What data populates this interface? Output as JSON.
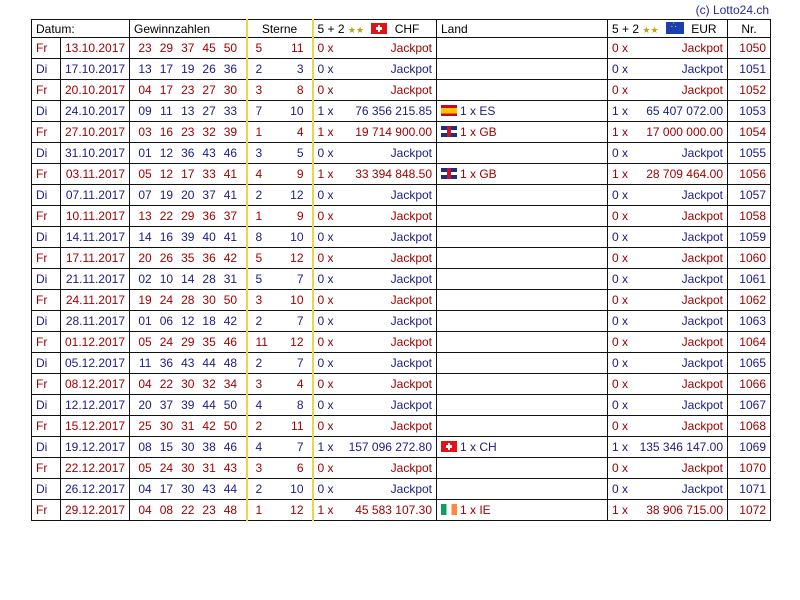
{
  "copyright": "(c) Lotto24.ch",
  "headers": {
    "datum": "Datum:",
    "gewinnzahlen": "Gewinnzahlen",
    "sterne": "Sterne",
    "chf_label": "5 + 2",
    "chf_cur": "CHF",
    "land": "Land",
    "eur_label": "5 + 2",
    "eur_cur": "EUR",
    "nr": "Nr."
  },
  "rows": [
    {
      "day": "Fr",
      "date": "13.10.2017",
      "nums": [
        "23",
        "29",
        "37",
        "45",
        "50"
      ],
      "stars": [
        "5",
        "11"
      ],
      "chf_x": "0 x",
      "chf_amt": "Jackpot",
      "land": "",
      "flag": "",
      "eur_x": "0 x",
      "eur_amt": "Jackpot",
      "nr": "1050"
    },
    {
      "day": "Di",
      "date": "17.10.2017",
      "nums": [
        "13",
        "17",
        "19",
        "26",
        "36"
      ],
      "stars": [
        "2",
        "3"
      ],
      "chf_x": "0 x",
      "chf_amt": "Jackpot",
      "land": "",
      "flag": "",
      "eur_x": "0 x",
      "eur_amt": "Jackpot",
      "nr": "1051"
    },
    {
      "day": "Fr",
      "date": "20.10.2017",
      "nums": [
        "04",
        "17",
        "23",
        "27",
        "30"
      ],
      "stars": [
        "3",
        "8"
      ],
      "chf_x": "0 x",
      "chf_amt": "Jackpot",
      "land": "",
      "flag": "",
      "eur_x": "0 x",
      "eur_amt": "Jackpot",
      "nr": "1052"
    },
    {
      "day": "Di",
      "date": "24.10.2017",
      "nums": [
        "09",
        "11",
        "13",
        "27",
        "33"
      ],
      "stars": [
        "7",
        "10"
      ],
      "chf_x": "1 x",
      "chf_amt": "76 356 215.85",
      "land": "1 x ES",
      "flag": "es",
      "eur_x": "1 x",
      "eur_amt": "65 407 072.00",
      "nr": "1053"
    },
    {
      "day": "Fr",
      "date": "27.10.2017",
      "nums": [
        "03",
        "16",
        "23",
        "32",
        "39"
      ],
      "stars": [
        "1",
        "4"
      ],
      "chf_x": "1 x",
      "chf_amt": "19 714 900.00",
      "land": "1 x GB",
      "flag": "gb",
      "eur_x": "1 x",
      "eur_amt": "17 000 000.00",
      "nr": "1054"
    },
    {
      "day": "Di",
      "date": "31.10.2017",
      "nums": [
        "01",
        "12",
        "36",
        "43",
        "46"
      ],
      "stars": [
        "3",
        "5"
      ],
      "chf_x": "0 x",
      "chf_amt": "Jackpot",
      "land": "",
      "flag": "",
      "eur_x": "0 x",
      "eur_amt": "Jackpot",
      "nr": "1055"
    },
    {
      "day": "Fr",
      "date": "03.11.2017",
      "nums": [
        "05",
        "12",
        "17",
        "33",
        "41"
      ],
      "stars": [
        "4",
        "9"
      ],
      "chf_x": "1 x",
      "chf_amt": "33 394 848.50",
      "land": "1 x GB",
      "flag": "gb",
      "eur_x": "1 x",
      "eur_amt": "28 709 464.00",
      "nr": "1056"
    },
    {
      "day": "Di",
      "date": "07.11.2017",
      "nums": [
        "07",
        "19",
        "20",
        "37",
        "41"
      ],
      "stars": [
        "2",
        "12"
      ],
      "chf_x": "0 x",
      "chf_amt": "Jackpot",
      "land": "",
      "flag": "",
      "eur_x": "0 x",
      "eur_amt": "Jackpot",
      "nr": "1057"
    },
    {
      "day": "Fr",
      "date": "10.11.2017",
      "nums": [
        "13",
        "22",
        "29",
        "36",
        "37"
      ],
      "stars": [
        "1",
        "9"
      ],
      "chf_x": "0 x",
      "chf_amt": "Jackpot",
      "land": "",
      "flag": "",
      "eur_x": "0 x",
      "eur_amt": "Jackpot",
      "nr": "1058"
    },
    {
      "day": "Di",
      "date": "14.11.2017",
      "nums": [
        "14",
        "16",
        "39",
        "40",
        "41"
      ],
      "stars": [
        "8",
        "10"
      ],
      "chf_x": "0 x",
      "chf_amt": "Jackpot",
      "land": "",
      "flag": "",
      "eur_x": "0 x",
      "eur_amt": "Jackpot",
      "nr": "1059"
    },
    {
      "day": "Fr",
      "date": "17.11.2017",
      "nums": [
        "20",
        "26",
        "35",
        "36",
        "42"
      ],
      "stars": [
        "5",
        "12"
      ],
      "chf_x": "0 x",
      "chf_amt": "Jackpot",
      "land": "",
      "flag": "",
      "eur_x": "0 x",
      "eur_amt": "Jackpot",
      "nr": "1060"
    },
    {
      "day": "Di",
      "date": "21.11.2017",
      "nums": [
        "02",
        "10",
        "14",
        "28",
        "31"
      ],
      "stars": [
        "5",
        "7"
      ],
      "chf_x": "0 x",
      "chf_amt": "Jackpot",
      "land": "",
      "flag": "",
      "eur_x": "0 x",
      "eur_amt": "Jackpot",
      "nr": "1061"
    },
    {
      "day": "Fr",
      "date": "24.11.2017",
      "nums": [
        "19",
        "24",
        "28",
        "30",
        "50"
      ],
      "stars": [
        "3",
        "10"
      ],
      "chf_x": "0 x",
      "chf_amt": "Jackpot",
      "land": "",
      "flag": "",
      "eur_x": "0 x",
      "eur_amt": "Jackpot",
      "nr": "1062"
    },
    {
      "day": "Di",
      "date": "28.11.2017",
      "nums": [
        "01",
        "06",
        "12",
        "18",
        "42"
      ],
      "stars": [
        "2",
        "7"
      ],
      "chf_x": "0 x",
      "chf_amt": "Jackpot",
      "land": "",
      "flag": "",
      "eur_x": "0 x",
      "eur_amt": "Jackpot",
      "nr": "1063"
    },
    {
      "day": "Fr",
      "date": "01.12.2017",
      "nums": [
        "05",
        "24",
        "29",
        "35",
        "46"
      ],
      "stars": [
        "11",
        "12"
      ],
      "chf_x": "0 x",
      "chf_amt": "Jackpot",
      "land": "",
      "flag": "",
      "eur_x": "0 x",
      "eur_amt": "Jackpot",
      "nr": "1064"
    },
    {
      "day": "Di",
      "date": "05.12.2017",
      "nums": [
        "11",
        "36",
        "43",
        "44",
        "48"
      ],
      "stars": [
        "2",
        "7"
      ],
      "chf_x": "0 x",
      "chf_amt": "Jackpot",
      "land": "",
      "flag": "",
      "eur_x": "0 x",
      "eur_amt": "Jackpot",
      "nr": "1065"
    },
    {
      "day": "Fr",
      "date": "08.12.2017",
      "nums": [
        "04",
        "22",
        "30",
        "32",
        "34"
      ],
      "stars": [
        "3",
        "4"
      ],
      "chf_x": "0 x",
      "chf_amt": "Jackpot",
      "land": "",
      "flag": "",
      "eur_x": "0 x",
      "eur_amt": "Jackpot",
      "nr": "1066"
    },
    {
      "day": "Di",
      "date": "12.12.2017",
      "nums": [
        "20",
        "37",
        "39",
        "44",
        "50"
      ],
      "stars": [
        "4",
        "8"
      ],
      "chf_x": "0 x",
      "chf_amt": "Jackpot",
      "land": "",
      "flag": "",
      "eur_x": "0 x",
      "eur_amt": "Jackpot",
      "nr": "1067"
    },
    {
      "day": "Fr",
      "date": "15.12.2017",
      "nums": [
        "25",
        "30",
        "31",
        "42",
        "50"
      ],
      "stars": [
        "2",
        "11"
      ],
      "chf_x": "0 x",
      "chf_amt": "Jackpot",
      "land": "",
      "flag": "",
      "eur_x": "0 x",
      "eur_amt": "Jackpot",
      "nr": "1068"
    },
    {
      "day": "Di",
      "date": "19.12.2017",
      "nums": [
        "08",
        "15",
        "30",
        "38",
        "46"
      ],
      "stars": [
        "4",
        "7"
      ],
      "chf_x": "1 x",
      "chf_amt": "157 096 272.80",
      "land": "1 x CH",
      "flag": "ch",
      "eur_x": "1 x",
      "eur_amt": "135 346 147.00",
      "nr": "1069"
    },
    {
      "day": "Fr",
      "date": "22.12.2017",
      "nums": [
        "05",
        "24",
        "30",
        "31",
        "43"
      ],
      "stars": [
        "3",
        "6"
      ],
      "chf_x": "0 x",
      "chf_amt": "Jackpot",
      "land": "",
      "flag": "",
      "eur_x": "0 x",
      "eur_amt": "Jackpot",
      "nr": "1070"
    },
    {
      "day": "Di",
      "date": "26.12.2017",
      "nums": [
        "04",
        "17",
        "30",
        "43",
        "44"
      ],
      "stars": [
        "2",
        "10"
      ],
      "chf_x": "0 x",
      "chf_amt": "Jackpot",
      "land": "",
      "flag": "",
      "eur_x": "0 x",
      "eur_amt": "Jackpot",
      "nr": "1071"
    },
    {
      "day": "Fr",
      "date": "29.12.2017",
      "nums": [
        "04",
        "08",
        "22",
        "23",
        "48"
      ],
      "stars": [
        "1",
        "12"
      ],
      "chf_x": "1 x",
      "chf_amt": "45 583 107.30",
      "land": "1 x IE",
      "flag": "ie",
      "eur_x": "1 x",
      "eur_amt": "38 906 715.00",
      "nr": "1072"
    }
  ]
}
